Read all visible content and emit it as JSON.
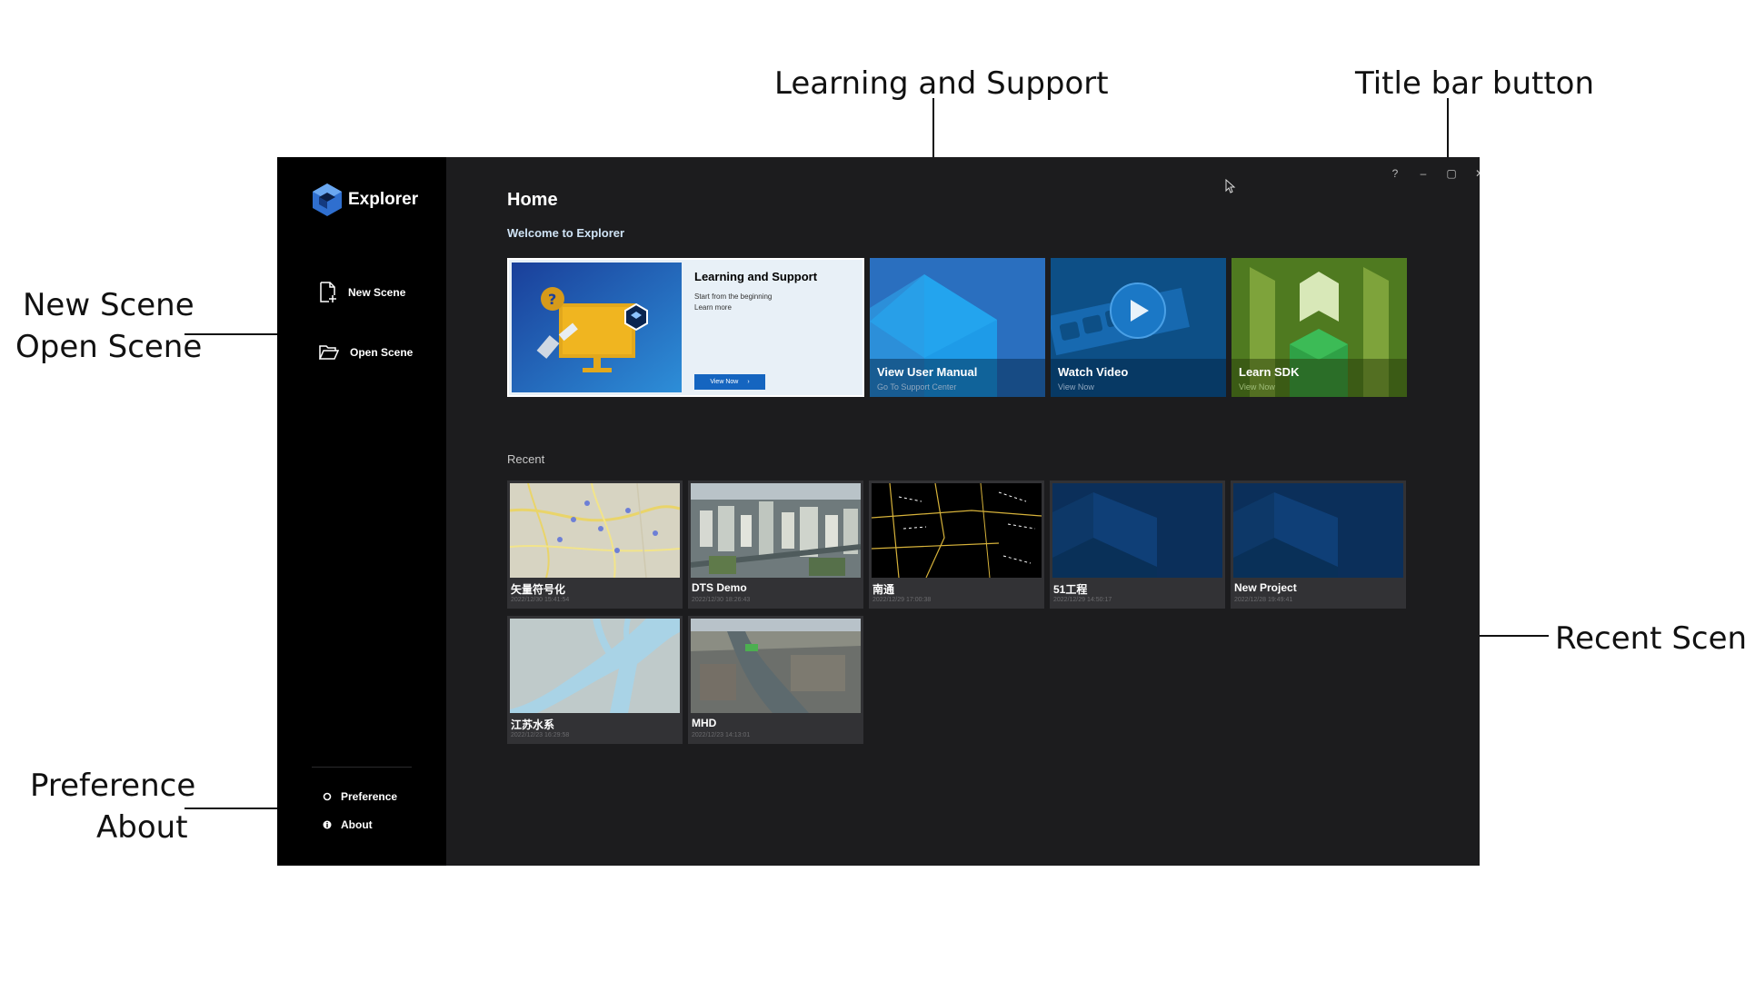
{
  "callouts": {
    "learning_support": "Learning and Support",
    "title_bar": "Title bar button",
    "new_scene": "New  Scene",
    "open_scene": "Open Scene",
    "preference": "Preference",
    "about": "About",
    "recent_scene": "Recent Scene"
  },
  "app": {
    "name": "Explorer",
    "sidebar": {
      "new_scene": "New Scene",
      "open_scene": "Open Scene",
      "preference": "Preference",
      "about": "About"
    },
    "titlebar": {
      "help": "?",
      "minimize": "–",
      "maximize": "▢",
      "close": "✕"
    },
    "home": {
      "title": "Home",
      "welcome": "Welcome to Explorer",
      "learning_card": {
        "title": "Learning and Support",
        "line1": "Start from the beginning",
        "line2": "Learn more",
        "button": "View Now"
      },
      "tiles": [
        {
          "title": "View User Manual",
          "sub": "Go To Support Center",
          "color": "#2a6fbf"
        },
        {
          "title": "Watch Video",
          "sub": "View Now",
          "color": "#0d4f86"
        },
        {
          "title": "Learn SDK",
          "sub": "View Now",
          "color": "#4f7a20"
        }
      ],
      "recent_label": "Recent",
      "recent": [
        {
          "name": "矢量符号化",
          "date": "2022/12/30 15:41:54"
        },
        {
          "name": "DTS Demo",
          "date": "2022/12/30 18:26:43"
        },
        {
          "name": "南通",
          "date": "2022/12/29 17:00:38"
        },
        {
          "name": "51工程",
          "date": "2022/12/29 14:50:17"
        },
        {
          "name": "New Project",
          "date": "2022/12/28 19:49:41"
        },
        {
          "name": "江苏水系",
          "date": "2022/12/23 16:29:58"
        },
        {
          "name": "MHD",
          "date": "2022/12/23 14:13:01"
        }
      ]
    }
  }
}
